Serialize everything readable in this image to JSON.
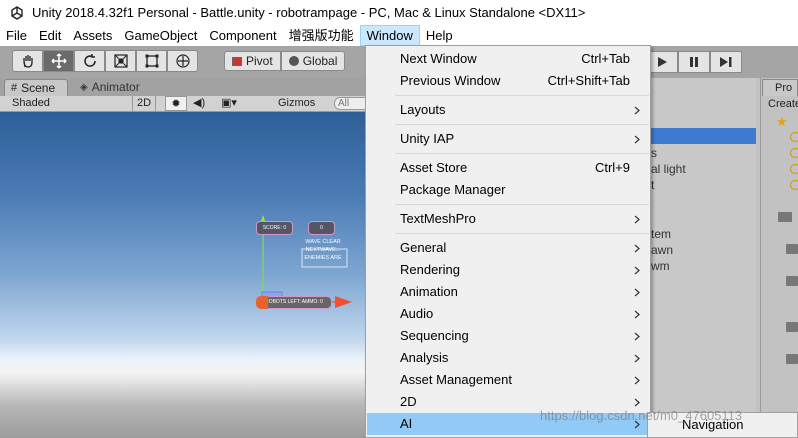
{
  "window": {
    "title": "Unity 2018.4.32f1 Personal - Battle.unity - robotrampage - PC, Mac & Linux Standalone <DX11>"
  },
  "menubar": {
    "items": [
      "File",
      "Edit",
      "Assets",
      "GameObject",
      "Component",
      "增强版功能",
      "Window",
      "Help"
    ],
    "active": "Window"
  },
  "toolbar": {
    "tools": [
      "hand-tool",
      "move-tool",
      "rotate-tool",
      "scale-tool",
      "rect-tool",
      "transform-tool"
    ],
    "pivot_label": "Pivot",
    "global_label": "Global"
  },
  "scene_tabs": {
    "scene_label": "Scene",
    "animator_label": "Animator"
  },
  "scene_toolbar": {
    "shading_mode": "Shaded",
    "mode_2d": "2D",
    "gizmos_label": "Gizmos",
    "search_placeholder": "All"
  },
  "scene": {
    "ui_label_a": "SCORE: 0",
    "ui_label_b": "0",
    "wave_text_line1": "WAVE CLEAR",
    "wave_text_line2": "NEXTWAVE...",
    "wave_text_line3": "ENEMIES ARE",
    "bar_label": "ROBOTS LEFT: AMMO: 0"
  },
  "hierarchy": {
    "fragments": [
      "s",
      "al light",
      "t",
      "tem",
      "awn",
      "wm"
    ]
  },
  "project": {
    "tab_label": "Pro",
    "create_label": "Create"
  },
  "window_menu": {
    "items": [
      {
        "label": "Next Window",
        "shortcut": "Ctrl+Tab"
      },
      {
        "label": "Previous Window",
        "shortcut": "Ctrl+Shift+Tab"
      },
      {
        "label": "Layouts",
        "submenu": true
      },
      {
        "label": "Unity IAP",
        "submenu": true
      },
      {
        "label": "Asset Store",
        "shortcut": "Ctrl+9"
      },
      {
        "label": "Package Manager"
      },
      {
        "label": "TextMeshPro",
        "submenu": true
      },
      {
        "label": "General",
        "submenu": true
      },
      {
        "label": "Rendering",
        "submenu": true
      },
      {
        "label": "Animation",
        "submenu": true
      },
      {
        "label": "Audio",
        "submenu": true
      },
      {
        "label": "Sequencing",
        "submenu": true
      },
      {
        "label": "Analysis",
        "submenu": true
      },
      {
        "label": "Asset Management",
        "submenu": true
      },
      {
        "label": "2D",
        "submenu": true
      },
      {
        "label": "AI",
        "submenu": true,
        "highlighted": true
      }
    ]
  },
  "ai_submenu": {
    "items": [
      "Navigation"
    ]
  },
  "watermark": "https://blog.csdn.net/m0_47605113",
  "colors": {
    "menu_highlight": "#91c9f7",
    "active_menu_bg": "#cce8ff",
    "hierarchy_selection": "#3d7bd0"
  }
}
